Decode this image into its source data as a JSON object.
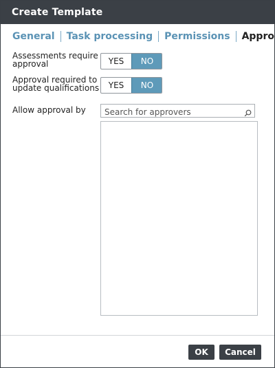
{
  "dialog": {
    "title": "Create Template"
  },
  "tabs": [
    {
      "label": "General",
      "active": false
    },
    {
      "label": "Task processing",
      "active": false
    },
    {
      "label": "Permissions",
      "active": false
    },
    {
      "label": "Approval",
      "active": true
    }
  ],
  "approval": {
    "assessments": {
      "label_line1": "Assessments require",
      "label_line2": "approval",
      "yes": "YES",
      "no": "NO",
      "selected": "NO"
    },
    "qualifications": {
      "label_line1": "Approval required to",
      "label_line2": "update qualifications",
      "yes": "YES",
      "no": "NO",
      "selected": "NO"
    },
    "approvers": {
      "label": "Allow approval by",
      "placeholder": "Search for approvers",
      "value": ""
    }
  },
  "footer": {
    "ok": "OK",
    "cancel": "Cancel"
  }
}
